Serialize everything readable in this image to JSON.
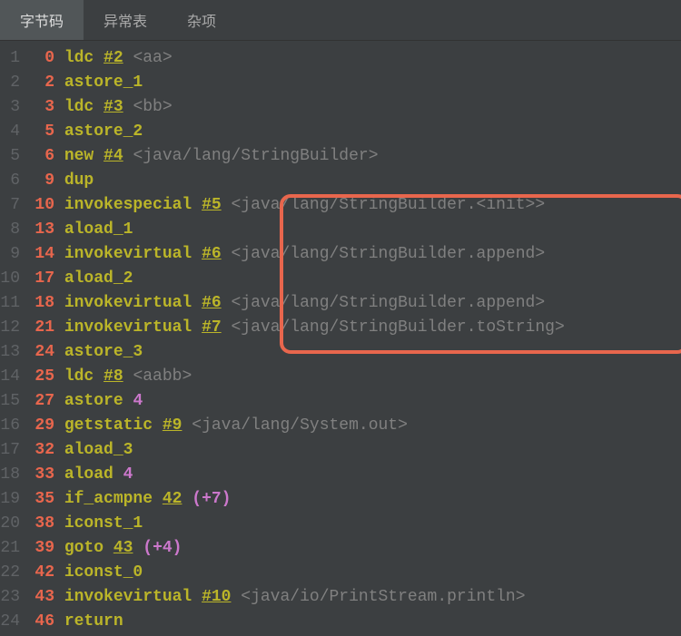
{
  "tabs": [
    {
      "label": "字节码",
      "active": true
    },
    {
      "label": "异常表",
      "active": false
    },
    {
      "label": "杂项",
      "active": false
    }
  ],
  "lines": [
    {
      "n": 1,
      "off": "0",
      "op": "ldc",
      "ref": "#2",
      "cmt": "<aa>"
    },
    {
      "n": 2,
      "off": "2",
      "op": "astore_1"
    },
    {
      "n": 3,
      "off": "3",
      "op": "ldc",
      "ref": "#3",
      "cmt": "<bb>"
    },
    {
      "n": 4,
      "off": "5",
      "op": "astore_2"
    },
    {
      "n": 5,
      "off": "6",
      "op": "new",
      "ref": "#4",
      "cmt": "<java/lang/StringBuilder>"
    },
    {
      "n": 6,
      "off": "9",
      "op": "dup"
    },
    {
      "n": 7,
      "off": "10",
      "op": "invokespecial",
      "ref": "#5",
      "cmt": "<java/lang/StringBuilder.<init>>"
    },
    {
      "n": 8,
      "off": "13",
      "op": "aload_1"
    },
    {
      "n": 9,
      "off": "14",
      "op": "invokevirtual",
      "ref": "#6",
      "cmt": "<java/lang/StringBuilder.append>"
    },
    {
      "n": 10,
      "off": "17",
      "op": "aload_2"
    },
    {
      "n": 11,
      "off": "18",
      "op": "invokevirtual",
      "ref": "#6",
      "cmt": "<java/lang/StringBuilder.append>"
    },
    {
      "n": 12,
      "off": "21",
      "op": "invokevirtual",
      "ref": "#7",
      "cmt": "<java/lang/StringBuilder.toString>"
    },
    {
      "n": 13,
      "off": "24",
      "op": "astore_3"
    },
    {
      "n": 14,
      "off": "25",
      "op": "ldc",
      "ref": "#8",
      "cmt": "<aabb>"
    },
    {
      "n": 15,
      "off": "27",
      "op": "astore",
      "num": "4"
    },
    {
      "n": 16,
      "off": "29",
      "op": "getstatic",
      "ref": "#9",
      "cmt": "<java/lang/System.out>"
    },
    {
      "n": 17,
      "off": "32",
      "op": "aload_3"
    },
    {
      "n": 18,
      "off": "33",
      "op": "aload",
      "num": "4"
    },
    {
      "n": 19,
      "off": "35",
      "op": "if_acmpne",
      "jmp": "42",
      "delta": "(+7)"
    },
    {
      "n": 20,
      "off": "38",
      "op": "iconst_1"
    },
    {
      "n": 21,
      "off": "39",
      "op": "goto",
      "jmp": "43",
      "delta": "(+4)"
    },
    {
      "n": 22,
      "off": "42",
      "op": "iconst_0"
    },
    {
      "n": 23,
      "off": "43",
      "op": "invokevirtual",
      "ref": "#10",
      "cmt": "<java/io/PrintStream.println>"
    },
    {
      "n": 24,
      "off": "46",
      "op": "return"
    }
  ]
}
